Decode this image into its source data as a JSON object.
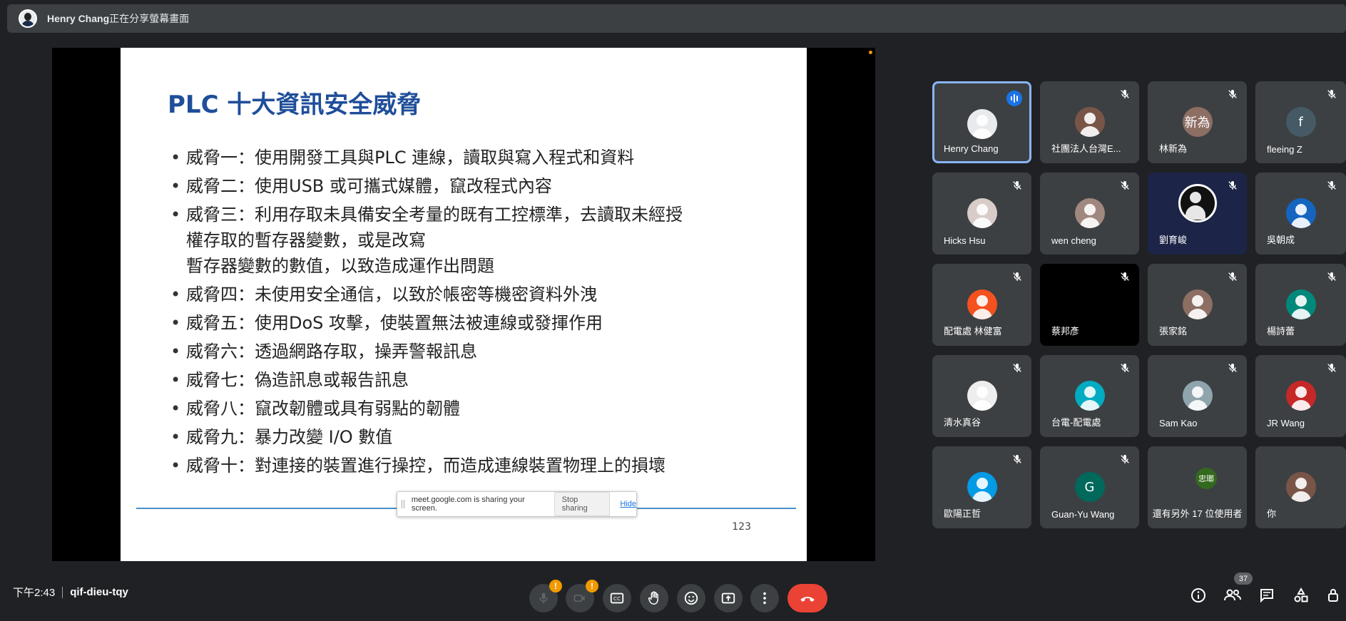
{
  "presenter_bar": {
    "name": "Henry Chang",
    "sharing_text": "正在分享螢幕畫面"
  },
  "slide": {
    "title": "PLC 十大資訊安全威脅",
    "bullets": [
      {
        "line1": "威脅一：使用開發工具與PLC 連線，讀取與寫入程式和資料"
      },
      {
        "line1": "威脅二：使用USB 或可攜式媒體，竄改程式內容"
      },
      {
        "line1": "威脅三：利用存取未具備安全考量的既有工控標準，去讀取未經授",
        "line2": "權存取的暫存器變數，或是改寫",
        "line3": "暫存器變數的數值，以致造成運作出問題"
      },
      {
        "line1": "威脅四：未使用安全通信，以致於帳密等機密資料外洩"
      },
      {
        "line1": "威脅五：使用DoS 攻擊，使裝置無法被連線或發揮作用"
      },
      {
        "line1": "威脅六：透過網路存取，操弄警報訊息"
      },
      {
        "line1": "威脅七：偽造訊息或報告訊息"
      },
      {
        "line1": "威脅八：竄改韌體或具有弱點的韌體"
      },
      {
        "line1": "威脅九：暴力改變 I/O 數值"
      },
      {
        "line1": "威脅十：對連接的裝置進行操控，而造成連線裝置物理上的損壞"
      }
    ],
    "page_number": "123"
  },
  "share_toast": {
    "message": "meet.google.com is sharing your screen.",
    "stop_label": "Stop sharing",
    "hide_label": "Hide"
  },
  "participants": [
    {
      "name": "Henry Chang",
      "color": "#e8eaed",
      "initial": "",
      "speaking": true
    },
    {
      "name": "社團法人台灣E...",
      "color": "#795548",
      "initial": ""
    },
    {
      "name": "林新為",
      "color": "#8d6e63",
      "initial": "新為"
    },
    {
      "name": "fleeing Z",
      "color": "#455a64",
      "initial": "f"
    },
    {
      "name": "Hicks Hsu",
      "color": "#d7ccc8",
      "initial": ""
    },
    {
      "name": "wen cheng",
      "color": "#a1887f",
      "initial": ""
    },
    {
      "name": "劉育峻",
      "color": "#111111",
      "initial": ""
    },
    {
      "name": "吳朝成",
      "color": "#1565c0",
      "initial": ""
    },
    {
      "name": "配電處 林健富",
      "color": "#f4511e",
      "initial": ""
    },
    {
      "name": "蔡邦彥",
      "color": "#000000",
      "initial": ""
    },
    {
      "name": "張家銘",
      "color": "#8d6e63",
      "initial": ""
    },
    {
      "name": "楊詩蕾",
      "color": "#00897b",
      "initial": ""
    },
    {
      "name": "清水真谷",
      "color": "#eeeeee",
      "initial": ""
    },
    {
      "name": "台電-配電處",
      "color": "#00acc1",
      "initial": ""
    },
    {
      "name": "Sam Kao",
      "color": "#90a4ae",
      "initial": ""
    },
    {
      "name": "JR Wang",
      "color": "#c62828",
      "initial": ""
    },
    {
      "name": "歐陽正哲",
      "color": "#039be5",
      "initial": ""
    },
    {
      "name": "Guan-Yu Wang",
      "color": "#00695c",
      "initial": "G"
    },
    {
      "name": "還有另外 17 位使用者",
      "color": "#33691e",
      "initial": "忠瑯"
    },
    {
      "name": "你",
      "color": "#795548",
      "initial": ""
    }
  ],
  "meeting": {
    "time": "下午2:43",
    "code": "qif-dieu-tqy",
    "participant_count": "37"
  },
  "controls": {
    "mic_icon": "mic-off-icon",
    "camera_icon": "camera-off-icon",
    "captions_icon": "captions-icon",
    "raise_hand_icon": "raise-hand-icon",
    "emoji_icon": "emoji-icon",
    "present_icon": "present-screen-icon",
    "more_icon": "more-options-icon",
    "end_call_icon": "end-call-icon",
    "warning_badge": "!"
  },
  "colors": {
    "background": "#202124",
    "tile": "#3c4043",
    "accent": "#8ab4f8",
    "end_call": "#ea4335",
    "warning": "#f29900",
    "slide_title": "#1f4e9a"
  }
}
